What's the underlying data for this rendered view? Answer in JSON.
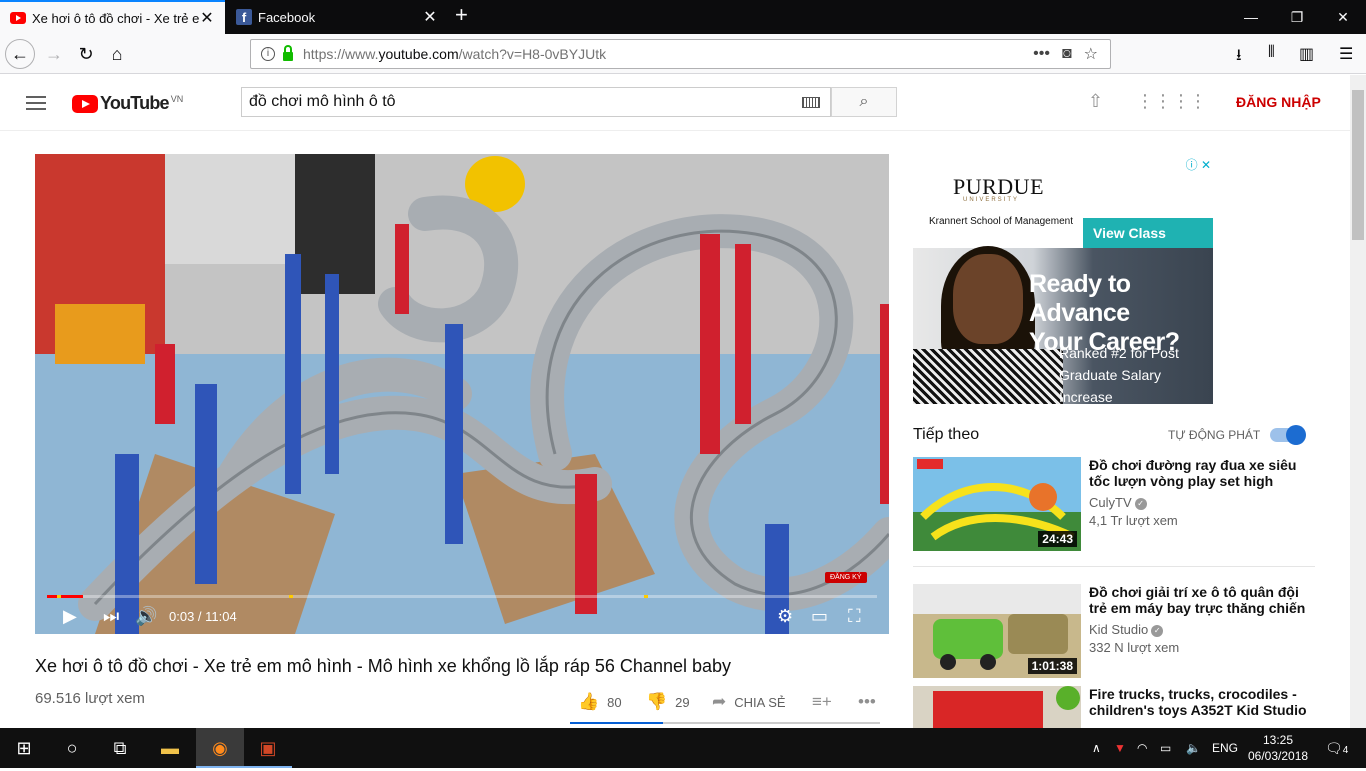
{
  "browser": {
    "tabs": [
      {
        "title": "Xe hơi ô tô đồ chơi - Xe trẻ em",
        "favicon": "youtube-icon"
      },
      {
        "title": "Facebook",
        "favicon": "facebook-icon"
      }
    ],
    "url_prefix": "https://www.",
    "url_domain": "youtube.com",
    "url_path": "/watch?v=H8-0vBYJUtk"
  },
  "youtube": {
    "logo_text": "YouTube",
    "region": "VN",
    "search_value": "đồ chơi mô hình ô tô",
    "signin_label": "ĐĂNG NHẬP"
  },
  "player": {
    "time": "0:03 / 11:04",
    "subscribe_badge": "ĐĂNG KÝ",
    "progress_fraction": 0.005
  },
  "video": {
    "title": "Xe hơi ô tô đồ chơi - Xe trẻ em mô hình - Mô hình xe khổng lồ lắp ráp 56 Channel baby",
    "views": "69.516 lượt xem",
    "likes": "80",
    "dislikes": "29",
    "share_label": "CHIA SẺ"
  },
  "ad": {
    "brand": "PURDUE",
    "brand_sub": "UNIVERSITY",
    "school": "Krannert School of Management",
    "cta": "View Class Profile",
    "headline_1": "Ready to Advance",
    "headline_2": "Your Career?",
    "sub_1": "Ranked #2 for Post",
    "sub_2": "Graduate Salary Increase"
  },
  "sidebar": {
    "up_next": "Tiếp theo",
    "autoplay_label": "TỰ ĐỘNG PHÁT",
    "autoplay_on": true,
    "items": [
      {
        "title": "Đồ chơi đường ray đua xe siêu tốc lượn vòng play set high",
        "channel": "CulyTV",
        "views": "4,1 Tr lượt xem",
        "duration": "24:43"
      },
      {
        "title": "Đồ chơi giải trí xe ô tô quân đội trẻ em máy bay trực thăng chiến",
        "channel": "Kid Studio",
        "views": "332 N lượt xem",
        "duration": "1:01:38"
      },
      {
        "title": "Fire trucks, trucks, crocodiles - children's toys A352T Kid Studio",
        "channel": "",
        "views": "",
        "duration": ""
      }
    ]
  },
  "taskbar": {
    "lang": "ENG",
    "time": "13:25",
    "date": "06/03/2018",
    "notifications": "4"
  },
  "colors": {
    "yt_red": "#ff0000",
    "signin": "#cc0000",
    "accent_blue": "#0a84ff",
    "ad_teal": "#1fb2b2"
  }
}
